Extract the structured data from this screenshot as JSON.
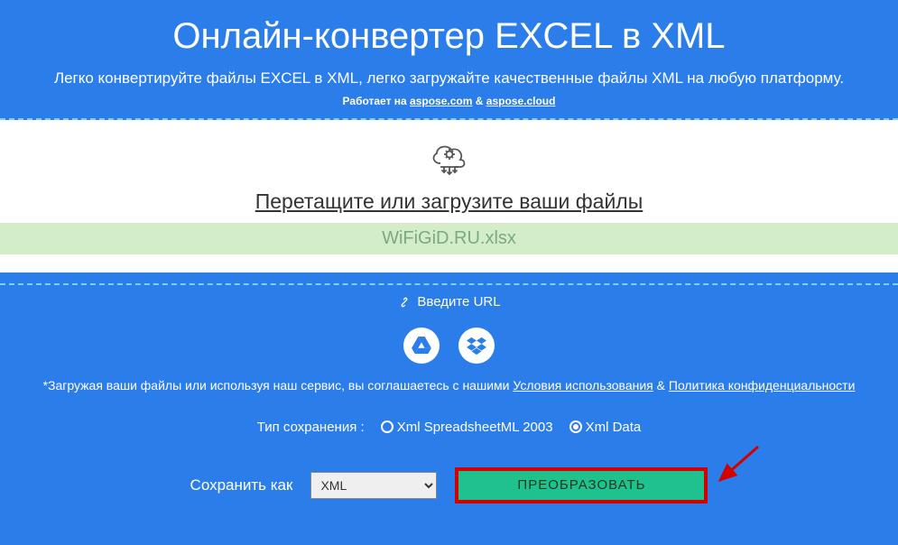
{
  "header": {
    "title": "Онлайн-конвертер EXCEL в XML",
    "subtitle": "Легко конвертируйте файлы EXCEL в XML, легко загружайте качественные файлы XML на любую платформу.",
    "powered_prefix": "Работает на ",
    "powered_link1": "aspose.com",
    "powered_amp": " & ",
    "powered_link2": "aspose.cloud"
  },
  "dropzone": {
    "prompt": "Перетащите или загрузите ваши файлы",
    "file_name": "WiFiGiD.RU.xlsx"
  },
  "url": {
    "label": "Введите URL"
  },
  "legal": {
    "prefix": "*Загружая ваши файлы или используя наш сервис, вы соглашаетесь с нашими ",
    "terms": "Условия использования",
    "amp": " & ",
    "privacy": "Политика конфиденциальности"
  },
  "save_type": {
    "label": "Тип сохранения :",
    "option1": "Xml SpreadsheetML 2003",
    "option2": "Xml Data"
  },
  "action": {
    "save_as_label": "Сохранить как",
    "format": "XML",
    "convert": "ПРЕОБРАЗОВАТЬ"
  }
}
